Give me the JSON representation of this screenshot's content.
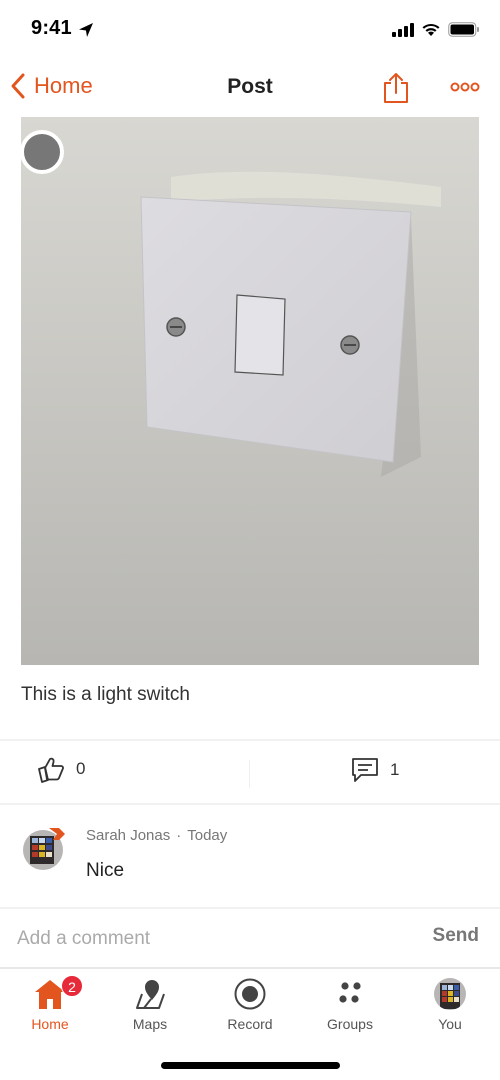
{
  "status_bar": {
    "time": "9:41",
    "icons": [
      "location-arrow-icon",
      "signal-icon",
      "wifi-icon",
      "battery-icon"
    ]
  },
  "nav": {
    "back_label": "Home",
    "title": "Post",
    "share_icon": "share-icon",
    "more_icon": "more-icon"
  },
  "colors": {
    "accent": "#e3551f",
    "badge": "#e62a3a",
    "text": "#222222",
    "muted": "#777777"
  },
  "post": {
    "image_alt": "Photo of a white light switch on a wall",
    "caption": "This is a light switch",
    "likes": "0",
    "comments": "1"
  },
  "comments": [
    {
      "author": "Sarah Jonas",
      "separator": "·",
      "time": "Today",
      "text": "Nice"
    }
  ],
  "comment_box": {
    "placeholder": "Add a comment",
    "value": "",
    "send_label": "Send"
  },
  "tab_bar": {
    "tabs": [
      {
        "label": "Home",
        "icon": "home-icon",
        "active": true,
        "badge": "2"
      },
      {
        "label": "Maps",
        "icon": "map-pin-icon",
        "active": false
      },
      {
        "label": "Record",
        "icon": "record-icon",
        "active": false
      },
      {
        "label": "Groups",
        "icon": "groups-icon",
        "active": false
      },
      {
        "label": "You",
        "icon": "profile-avatar",
        "active": false
      }
    ]
  }
}
